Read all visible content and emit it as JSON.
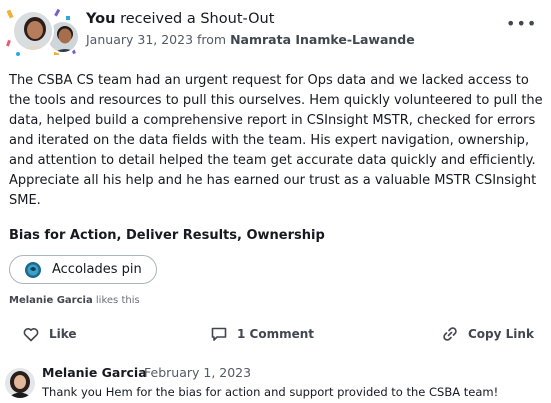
{
  "post": {
    "recipient": "You",
    "action_text": "received a Shout-Out",
    "date": "January 31, 2023",
    "from_label": "from",
    "author": "Namrata Inamke-Lawande",
    "more_icon": "more-horizontal-icon",
    "more_label": "•••",
    "body": "The CSBA CS team had an urgent request for Ops data and we lacked access to the tools and resources to pull this ourselves. Hem quickly volunteered to pull the data, helped build a comprehensive report in CSInsight MSTR, checked for errors and iterated on the data fields with the team. His expert navigation, ownership, and attention to detail helped the team get accurate data quickly and efficiently. Appreciate all his help and he has earned our trust as a valuable MSTR CSInsight SME.",
    "tags": "Bias for Action, Deliver Results, Ownership"
  },
  "pin": {
    "label": "Accolades pin",
    "icon": "accolades-pin-icon",
    "icon_color": "#1a6a8e"
  },
  "likes": {
    "name": "Melanie Garcia",
    "suffix": "likes this"
  },
  "actions": {
    "like": {
      "label": "Like",
      "icon": "heart-icon"
    },
    "comment": {
      "label": "1 Comment",
      "icon": "comment-icon"
    },
    "copy_link": {
      "label": "Copy Link",
      "icon": "link-icon"
    }
  },
  "comment": {
    "author": "Melanie Garcia",
    "date": "February 1, 2023",
    "text": "Thank you Hem for the bias for action and support provided to the CSBA team!"
  },
  "colors": {
    "text_primary": "#16191f",
    "text_secondary": "#545b64",
    "border": "#aab7b8",
    "confetti": [
      "#f2b134",
      "#7b5cd6",
      "#2ea8e0",
      "#e85d75"
    ]
  }
}
